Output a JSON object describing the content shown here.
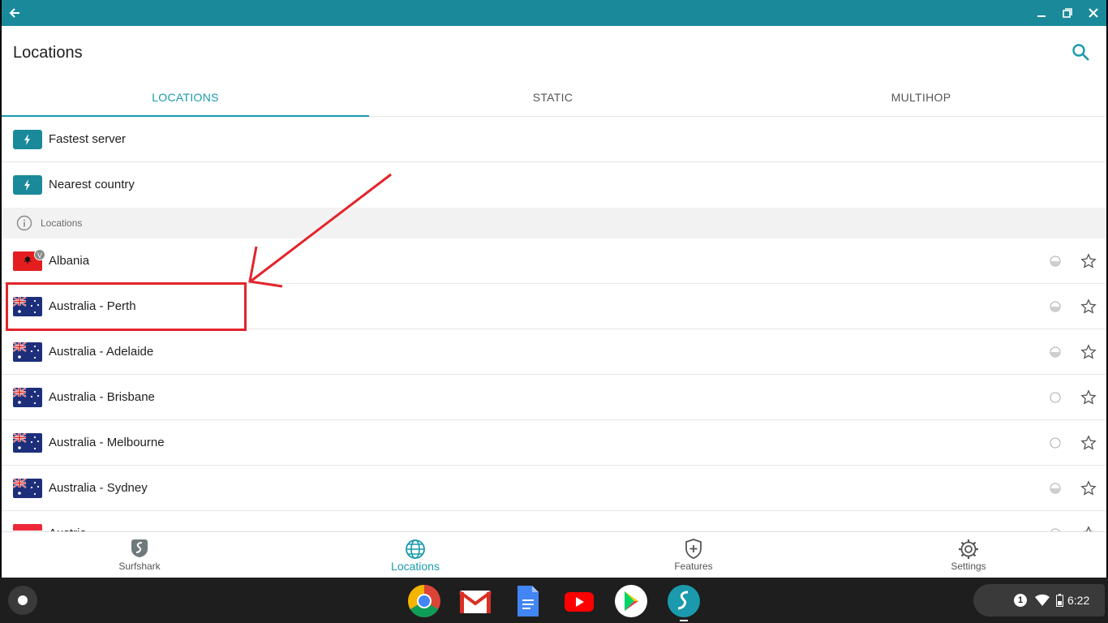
{
  "header": {
    "title": "Locations"
  },
  "tabs": [
    {
      "label": "LOCATIONS",
      "active": true
    },
    {
      "label": "STATIC",
      "active": false
    },
    {
      "label": "MULTIHOP",
      "active": false
    }
  ],
  "quick_connect": [
    {
      "label": "Fastest server",
      "icon": "bolt-icon"
    },
    {
      "label": "Nearest country",
      "icon": "bolt-icon"
    }
  ],
  "section": {
    "label": "Locations",
    "icon": "info-icon"
  },
  "locations": [
    {
      "label": "Albania",
      "flag": "albania-flag",
      "badge": "V",
      "load": "half"
    },
    {
      "label": "Australia - Perth",
      "flag": "australia-flag",
      "load": "half"
    },
    {
      "label": "Australia - Adelaide",
      "flag": "australia-flag",
      "load": "half"
    },
    {
      "label": "Australia - Brisbane",
      "flag": "australia-flag",
      "load": "empty"
    },
    {
      "label": "Australia - Melbourne",
      "flag": "australia-flag",
      "load": "empty"
    },
    {
      "label": "Australia - Sydney",
      "flag": "australia-flag",
      "load": "half"
    },
    {
      "label": "Austria",
      "flag": "austria-flag",
      "load": "empty"
    }
  ],
  "bottom_nav": [
    {
      "label": "Surfshark",
      "icon": "surfshark-icon",
      "active": false
    },
    {
      "label": "Locations",
      "icon": "globe-icon",
      "active": true
    },
    {
      "label": "Features",
      "icon": "shield-plus-icon",
      "active": false
    },
    {
      "label": "Settings",
      "icon": "gear-icon",
      "active": false
    }
  ],
  "shelf": {
    "apps": [
      "chrome-icon",
      "gmail-icon",
      "docs-icon",
      "youtube-icon",
      "play-store-icon",
      "surfshark-app-icon"
    ],
    "notification_count": "1",
    "clock": "6:22"
  },
  "colors": {
    "accent": "#1a9aac",
    "titlebar": "#1a8a9b",
    "annotation": "#e3242b"
  }
}
